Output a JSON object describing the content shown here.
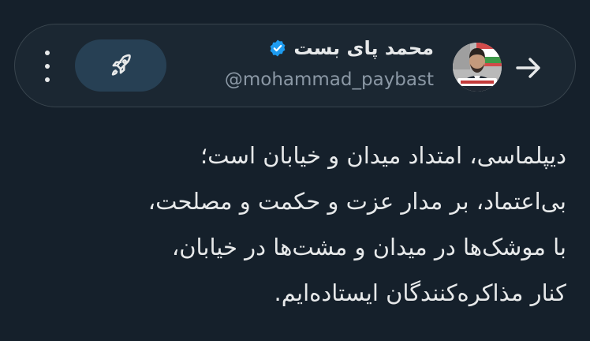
{
  "theme": {
    "background": "#15202b",
    "header_background": "#1b2732",
    "header_border": "#38444d",
    "boost_button": "#274054",
    "text_primary": "#e7e9ea",
    "text_secondary": "#8b98a5",
    "verified_badge": "#1d9bf0"
  },
  "header": {
    "back_icon": "arrow-right-icon",
    "avatar_caption": "محمد پای بست",
    "display_name": "محمد پای بست",
    "verified_icon": "verified-badge-icon",
    "handle": "@mohammad_paybast",
    "boost_icon": "rocket-icon",
    "more_icon": "more-vertical-icon"
  },
  "tweet": {
    "lines": [
      "دیپلماسی، امتداد میدان و خیابان است؛",
      "بی‌اعتماد، بر مدار عزت و حکمت و مصلحت،",
      "با موشک‌ها در میدان و مشت‌ها در خیابان،",
      "کنار مذاکره‌کنندگان ایستاده‌ایم."
    ]
  }
}
